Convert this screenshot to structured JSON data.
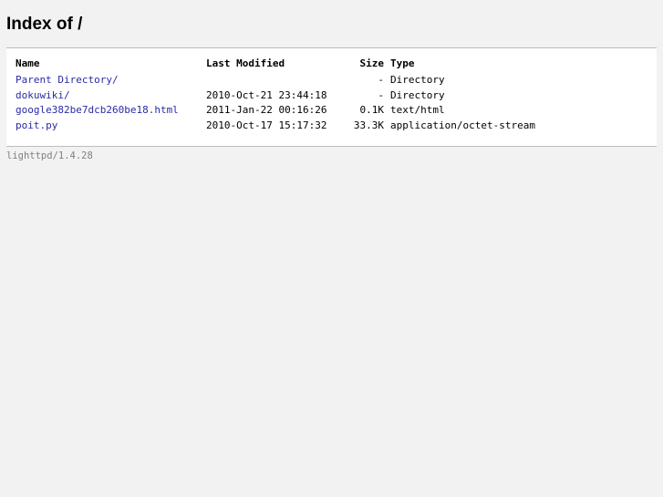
{
  "page": {
    "title": "Index of /"
  },
  "table": {
    "headers": {
      "name": "Name",
      "last_modified": "Last Modified",
      "size": "Size",
      "type": "Type"
    },
    "rows": [
      {
        "name": "Parent Directory/",
        "last_modified": "",
        "size": "-",
        "type": "Directory"
      },
      {
        "name": "dokuwiki/",
        "last_modified": "2010-Oct-21 23:44:18",
        "size": "-",
        "type": "Directory"
      },
      {
        "name": "google382be7dcb260be18.html",
        "last_modified": "2011-Jan-22 00:16:26",
        "size": "0.1K",
        "type": "text/html"
      },
      {
        "name": "poit.py",
        "last_modified": "2010-Oct-17 15:17:32",
        "size": "33.3K",
        "type": "application/octet-stream"
      }
    ]
  },
  "footer": {
    "server": "lighttpd/1.4.28"
  },
  "colors": {
    "link": "#2a2aa8",
    "background": "#f2f2f2",
    "panel": "#ffffff",
    "footer_text": "#808080"
  }
}
